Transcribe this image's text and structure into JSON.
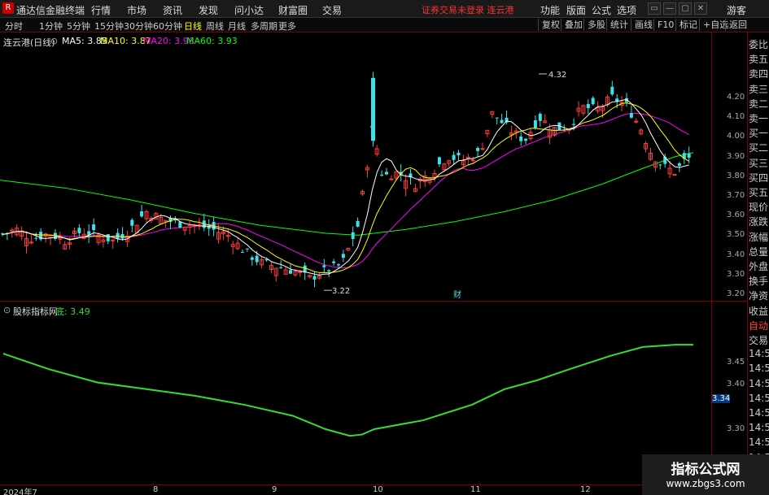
{
  "app": {
    "logo": "R",
    "title": "通达信金融终端",
    "menu": [
      "行情",
      "市场",
      "资讯",
      "发现",
      "问小达",
      "财富圈",
      "交易"
    ],
    "warning": "证券交易未登录  连云港",
    "right_menu": [
      "功能",
      "版面",
      "公式",
      "选项"
    ],
    "guest": "游客"
  },
  "toolbar": {
    "periods": [
      "分时",
      "1分钟",
      "5分钟",
      "15分钟",
      "30分钟",
      "60分钟",
      "日线",
      "周线",
      "月线",
      "多周期",
      "更多"
    ],
    "active_period": "日线",
    "buttons": [
      "复权",
      "叠加",
      "多股",
      "统计",
      "画线",
      "F10",
      "标记",
      "+自选",
      "返回"
    ]
  },
  "main_chart": {
    "stock_label": "连云港(日线)",
    "ma5": "MA5: 3.85",
    "ma10": "MA10: 3.87",
    "ma20": "MA20: 3.98",
    "ma60": "MA60: 3.93",
    "high_label": "4.32",
    "low_label": "3.22",
    "marker": "财",
    "price_ticks": [
      "4.20",
      "4.10",
      "4.00",
      "3.90",
      "3.80",
      "3.70",
      "3.60",
      "3.50",
      "3.40",
      "3.30",
      "3.20"
    ],
    "colors": {
      "up": "#ff3b3b",
      "down": "#40e0e8",
      "ma5": "#ffffff",
      "ma10": "#ffff00",
      "ma20": "#ff00ff",
      "ma60": "#00ff00"
    }
  },
  "indicator": {
    "name": "股标指标网",
    "series_label": "底: 3.49",
    "ticks": [
      "3.45",
      "3.40",
      "3.30"
    ],
    "current": "3.34",
    "color": "#33dd33"
  },
  "right_panel": [
    "委比",
    "卖五",
    "卖四",
    "卖三",
    "卖二",
    "卖一",
    "买一",
    "买二",
    "买三",
    "买四",
    "买五",
    "现价",
    "涨跌",
    "涨幅",
    "总量",
    "外盘",
    "换手",
    "净资",
    "收益",
    "自动",
    "交易",
    "14:56",
    "14:56",
    "14:56",
    "14:56",
    "14:56",
    "14:56",
    "14:56",
    "14:56"
  ],
  "date_axis": [
    "2024年7",
    "8",
    "9",
    "10",
    "11",
    "12"
  ],
  "watermark": {
    "line1": "指标公式网",
    "line2": "www.zbgs3.com"
  },
  "window_buttons": [
    "▭",
    "—",
    "▢",
    "✕"
  ]
}
